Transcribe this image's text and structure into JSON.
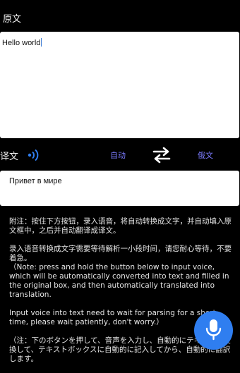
{
  "source": {
    "label": "原文",
    "text": "Hello world"
  },
  "toolbar": {
    "target_label": "译文",
    "icons": [
      "speaker-icon",
      "swap-icon",
      "microphone-icon"
    ],
    "from_language": "自动",
    "to_language": "俄文"
  },
  "target": {
    "text": "Привет в мире"
  },
  "notes": {
    "p1": "附注：按住下方按钮，录入语音，将自动转换成文字，并自动填入原文框中，之后并自动翻译成译文。",
    "p2": "录入语音转换成文字需要等待解析一小段时间，请您耐心等待，不要着急。",
    "p3": "（Note: press and hold the button below to input voice, which will be automatically converted into text and filled in the original box, and then automatically translated into translation.",
    "p4": "Input voice into text need to wait for parsing for a short time, please wait patiently, don't worry.）",
    "p5": "（注：下のボタンを押して、音声を入力し、自動的にテキストに変換して、テキストボックスに自動的に記入してから、自動的に翻訳します。"
  },
  "colors": {
    "accent": "#2f7ef0",
    "language_link": "#7b7bff",
    "background": "#000000"
  }
}
